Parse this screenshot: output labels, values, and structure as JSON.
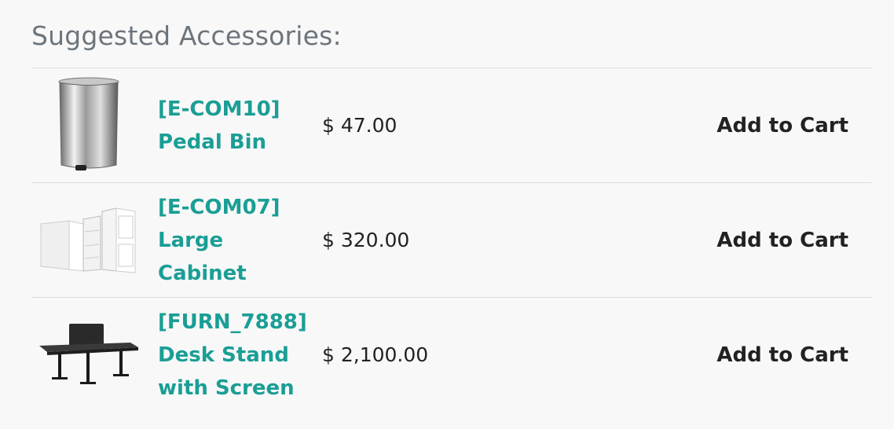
{
  "heading": "Suggested Accessories:",
  "accessories": [
    {
      "ref": "[E-COM10]",
      "name_lines": [
        "Pedal Bin"
      ],
      "price": "$ 47.00",
      "cart_label": "Add to Cart",
      "image": "pedal-bin"
    },
    {
      "ref": "[E-COM07]",
      "name_lines": [
        "Large",
        "Cabinet"
      ],
      "price": "$ 320.00",
      "cart_label": "Add to Cart",
      "image": "large-cabinet"
    },
    {
      "ref": "[FURN_7888]",
      "name_lines": [
        "Desk Stand",
        "with Screen"
      ],
      "price": "$ 2,100.00",
      "cart_label": "Add to Cart",
      "image": "desk-stand"
    }
  ],
  "colors": {
    "link": "#1a9e95",
    "heading": "#6c757d",
    "text": "#222222"
  }
}
